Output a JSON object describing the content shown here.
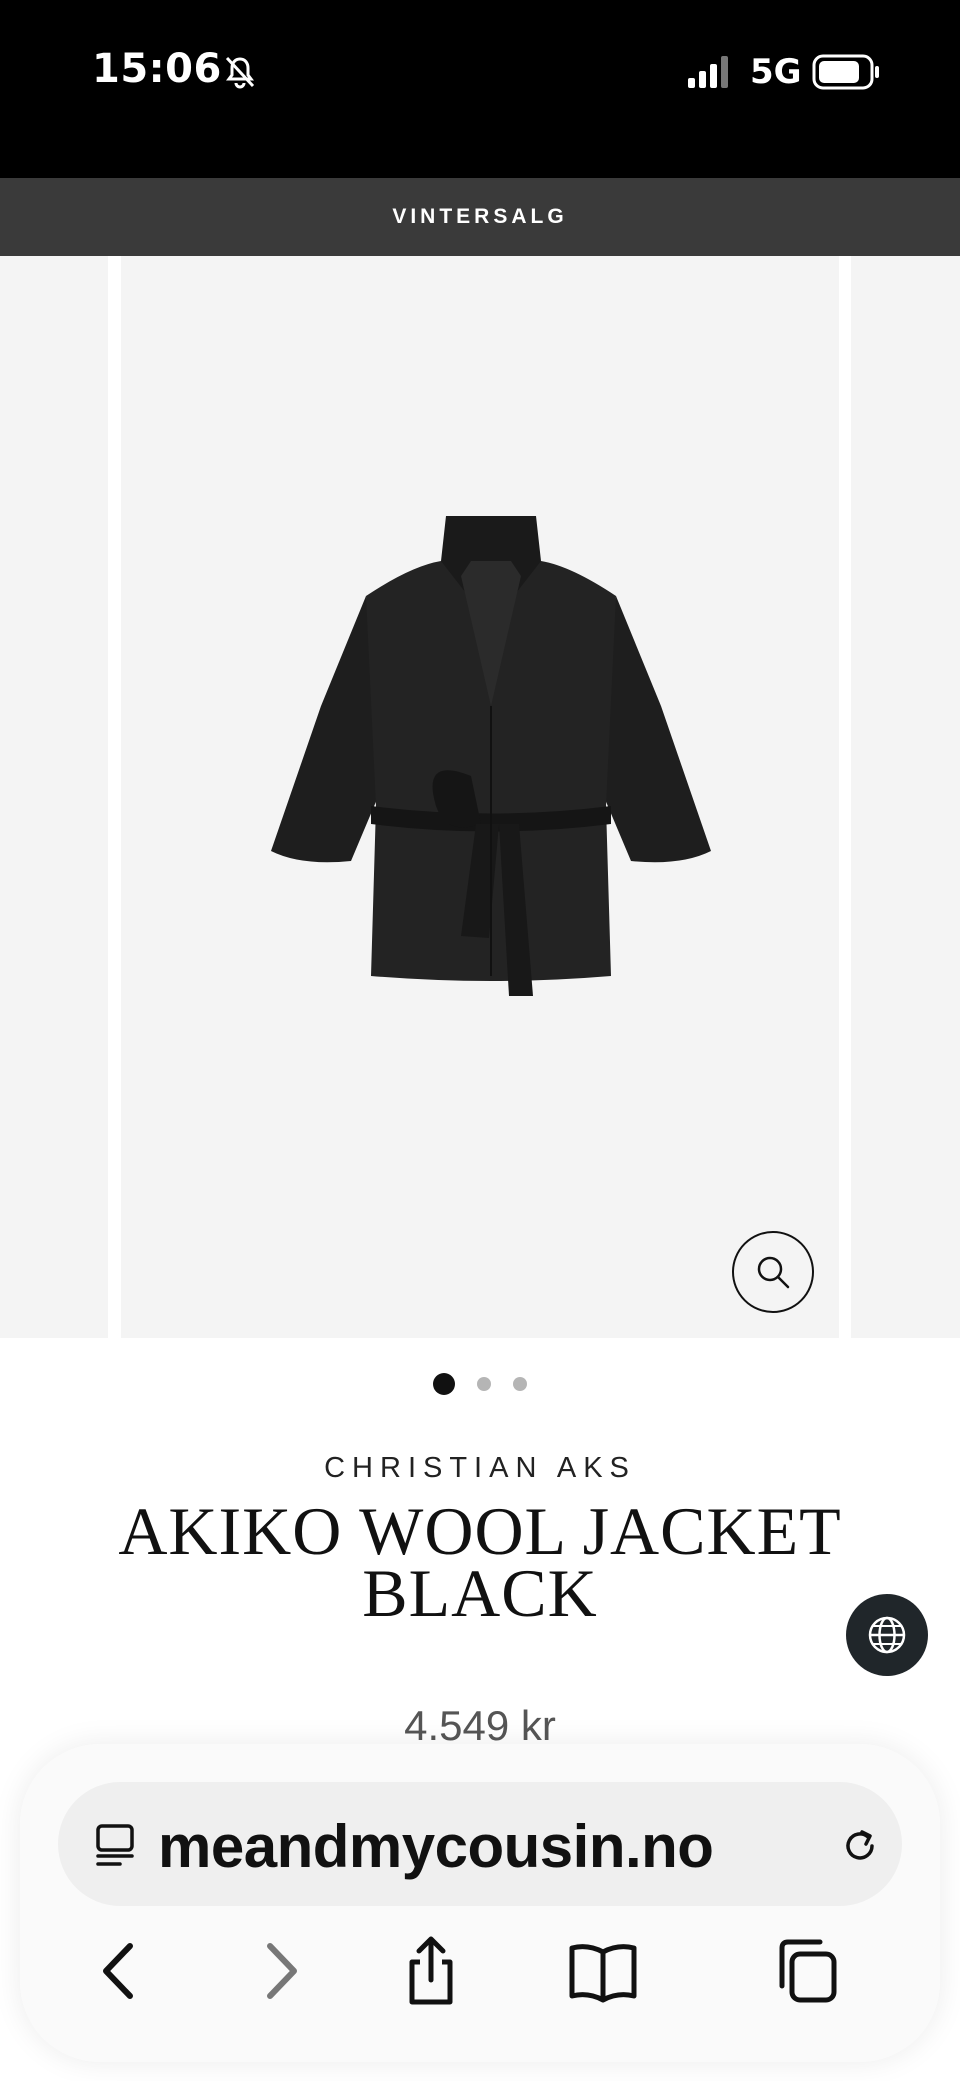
{
  "status_bar": {
    "time": "15:06",
    "network": "5G",
    "icons": [
      "bell-slash-icon",
      "signal-icon",
      "battery-icon"
    ]
  },
  "promo_banner": {
    "text": "VINTERSALG"
  },
  "gallery": {
    "image_alt": "jacket-image",
    "slide_count": 3,
    "active_slide": 1
  },
  "product": {
    "brand": "CHRISTIAN AKS",
    "title": "AKIKO WOOL JACKET BLACK",
    "price": "4.549 kr"
  },
  "browser": {
    "url": "meandmycousin.no",
    "icons": [
      "reader-icon",
      "reload-icon",
      "back-icon",
      "forward-icon",
      "share-icon",
      "bookmarks-icon",
      "tabs-icon"
    ]
  },
  "colors": {
    "status_bar_bg": "#000000",
    "banner_bg": "#3a3a3a",
    "image_bg": "#f4f4f4",
    "globe_button_bg": "#20262a"
  }
}
